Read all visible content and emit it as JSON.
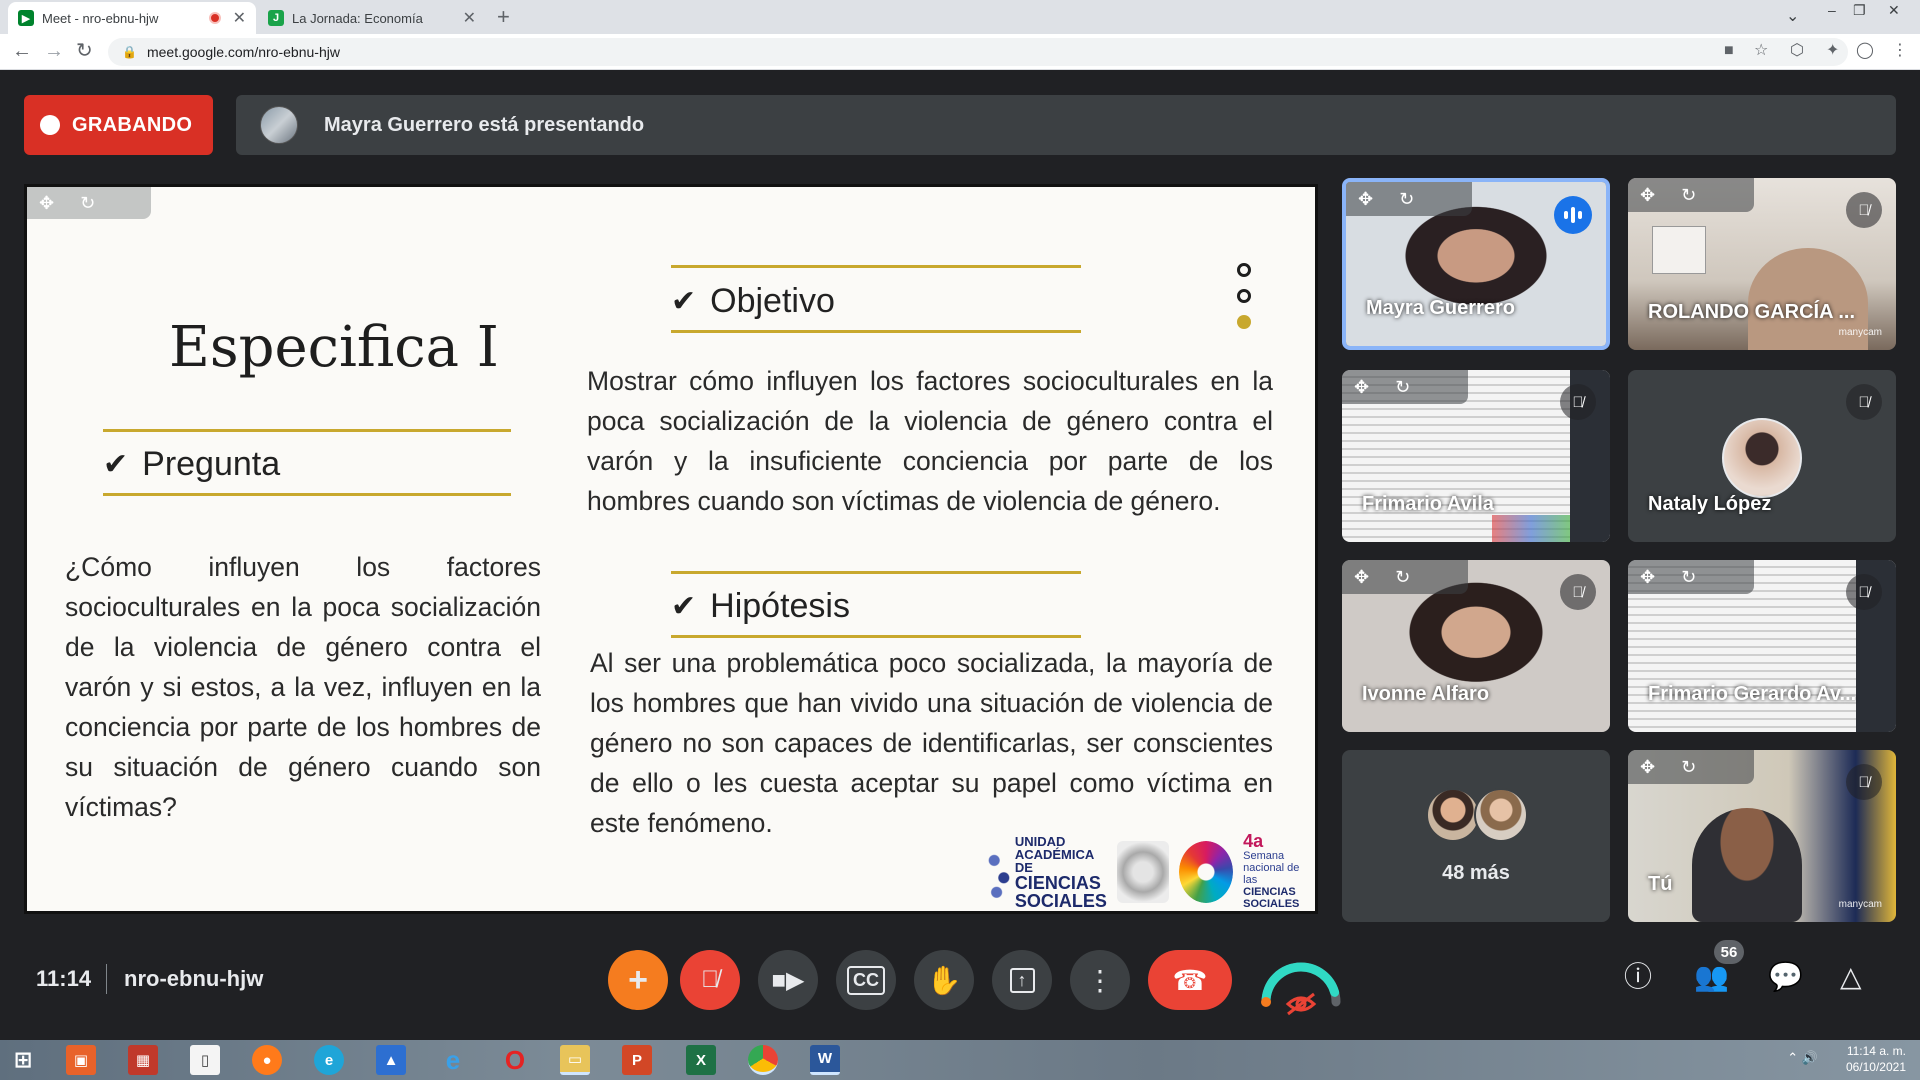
{
  "browser": {
    "tabs": [
      {
        "title": "Meet - nro-ebnu-hjw",
        "recording": true
      },
      {
        "title": "La Jornada: Economía",
        "recording": false
      }
    ],
    "url": "meet.google.com/nro-ebnu-hjw"
  },
  "meet": {
    "recording_label": "GRABANDO",
    "presenting_label": "Mayra Guerrero está presentando",
    "time": "11:14",
    "meeting_code": "nro-ebnu-hjw",
    "participant_count": "56"
  },
  "slide": {
    "title": "Especifica I",
    "pregunta": {
      "heading": "Pregunta",
      "text": "¿Cómo influyen los factores socioculturales en la poca socialización de la violencia de género contra el varón y si estos, a la vez, influyen en la conciencia por parte de los hombres de su situación de género cuando son víctimas?"
    },
    "objetivo": {
      "heading": "Objetivo",
      "text": "Mostrar cómo influyen los factores socioculturales en la poca socialización de la violencia de género contra el varón y la insuficiente conciencia por parte de los hombres cuando son víctimas de violencia de género."
    },
    "hipotesis": {
      "heading": "Hipótesis",
      "text": "Al ser una problemática poco socializada, la mayoría de los hombres que han vivido una situación de violencia de género no son capaces de identificarlas, ser conscientes de ello o les cuesta aceptar su papel como víctima en este fenómeno."
    },
    "logos": {
      "uacs_line1": "UNIDAD",
      "uacs_line2": "ACADÉMICA DE",
      "uacs_line3": "CIENCIAS",
      "uacs_line4": "SOCIALES",
      "semana_num": "4a",
      "semana_l1": "Semana",
      "semana_l2": "nacional de las",
      "semana_l3": "CIENCIAS",
      "semana_l4": "SOCIALES"
    },
    "accent_color": "#c8a82e"
  },
  "participants": [
    {
      "name": "Mayra Guerrero",
      "speaking": true
    },
    {
      "name": "ROLANDO GARCÍA ...",
      "muted": true,
      "overlay": "manycam"
    },
    {
      "name": "Frimario Avila",
      "muted": true
    },
    {
      "name": "Nataly López",
      "muted": true
    },
    {
      "name": "Ivonne Alfaro",
      "muted": true
    },
    {
      "name": "Frimario Gerardo Av...",
      "muted": true
    },
    {
      "more_label": "48 más"
    },
    {
      "name": "Tú",
      "muted": true,
      "overlay": "manycam"
    }
  ],
  "taskbar": {
    "time": "11:14 a. m.",
    "date": "06/10/2021"
  },
  "colors": {
    "recording_red": "#d93025",
    "meet_bg": "#202124",
    "tile_bg": "#3c4043",
    "speaking_border": "#8ab4f8",
    "raise_orange": "#f57c1f"
  }
}
